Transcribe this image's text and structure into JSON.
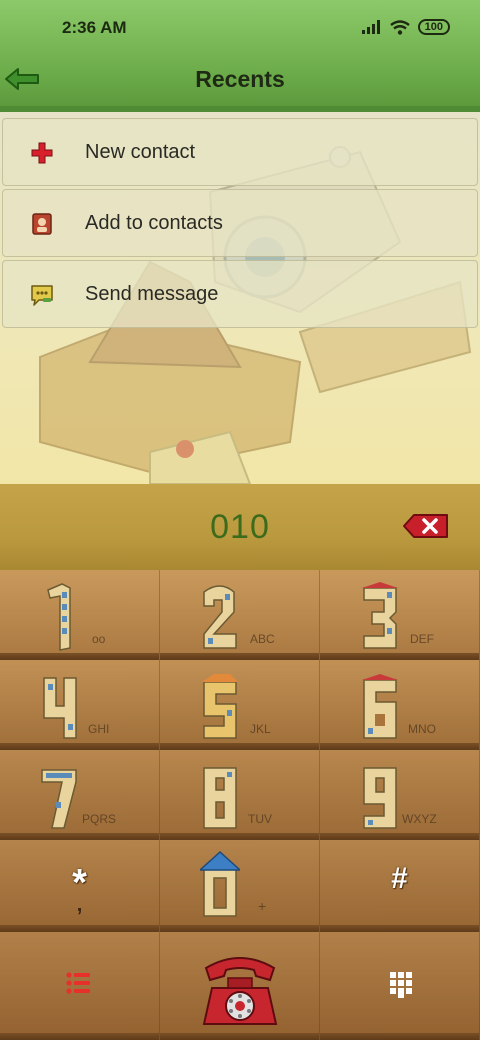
{
  "status_bar": {
    "time": "2:36 AM",
    "battery": "100"
  },
  "header": {
    "title": "Recents"
  },
  "menu": [
    {
      "label": "New contact",
      "icon": "plus-icon"
    },
    {
      "label": "Add to contacts",
      "icon": "contact-card-icon"
    },
    {
      "label": "Send message",
      "icon": "message-bubble-icon"
    }
  ],
  "dialer": {
    "number": "010"
  },
  "keypad": {
    "keys": [
      {
        "digit": "1",
        "letters": "oo"
      },
      {
        "digit": "2",
        "letters": "ABC"
      },
      {
        "digit": "3",
        "letters": "DEF"
      },
      {
        "digit": "4",
        "letters": "GHI"
      },
      {
        "digit": "5",
        "letters": "JKL"
      },
      {
        "digit": "6",
        "letters": "MNO"
      },
      {
        "digit": "7",
        "letters": "PQRS"
      },
      {
        "digit": "8",
        "letters": "TUV"
      },
      {
        "digit": "9",
        "letters": "WXYZ"
      }
    ],
    "star": "*",
    "star_sub": ",",
    "zero_sub": "+",
    "hash": "#"
  },
  "colors": {
    "header_green": "#6cab49",
    "number_green": "#3b6b1b",
    "delete_red": "#c8202a",
    "call_red": "#c8262e"
  }
}
